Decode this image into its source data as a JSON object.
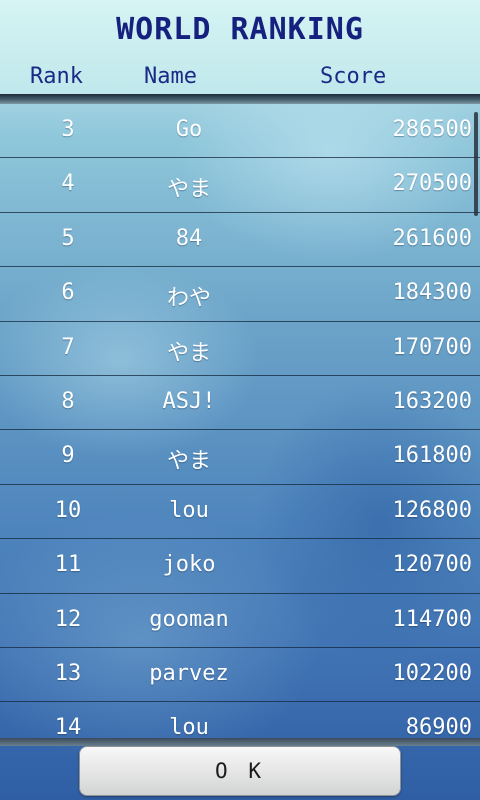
{
  "header": {
    "title": "WORLD RANKING",
    "columns": {
      "rank": "Rank",
      "name": "Name",
      "score": "Score"
    }
  },
  "ranking": [
    {
      "rank": "3",
      "name": "Go",
      "score": "286500"
    },
    {
      "rank": "4",
      "name": "やま",
      "score": "270500"
    },
    {
      "rank": "5",
      "name": "84",
      "score": "261600"
    },
    {
      "rank": "6",
      "name": "わや",
      "score": "184300"
    },
    {
      "rank": "7",
      "name": "やま",
      "score": "170700"
    },
    {
      "rank": "8",
      "name": "ASJ!",
      "score": "163200"
    },
    {
      "rank": "9",
      "name": "やま",
      "score": "161800"
    },
    {
      "rank": "10",
      "name": "lou",
      "score": "126800"
    },
    {
      "rank": "11",
      "name": "joko",
      "score": "120700"
    },
    {
      "rank": "12",
      "name": "gooman",
      "score": "114700"
    },
    {
      "rank": "13",
      "name": "parvez",
      "score": "102200"
    },
    {
      "rank": "14",
      "name": "lou",
      "score": "86900"
    }
  ],
  "footer": {
    "ok_label": "O K"
  },
  "colors": {
    "title": "#16207e",
    "row_text": "#ffffff",
    "row_divider": "#1e3a52"
  }
}
